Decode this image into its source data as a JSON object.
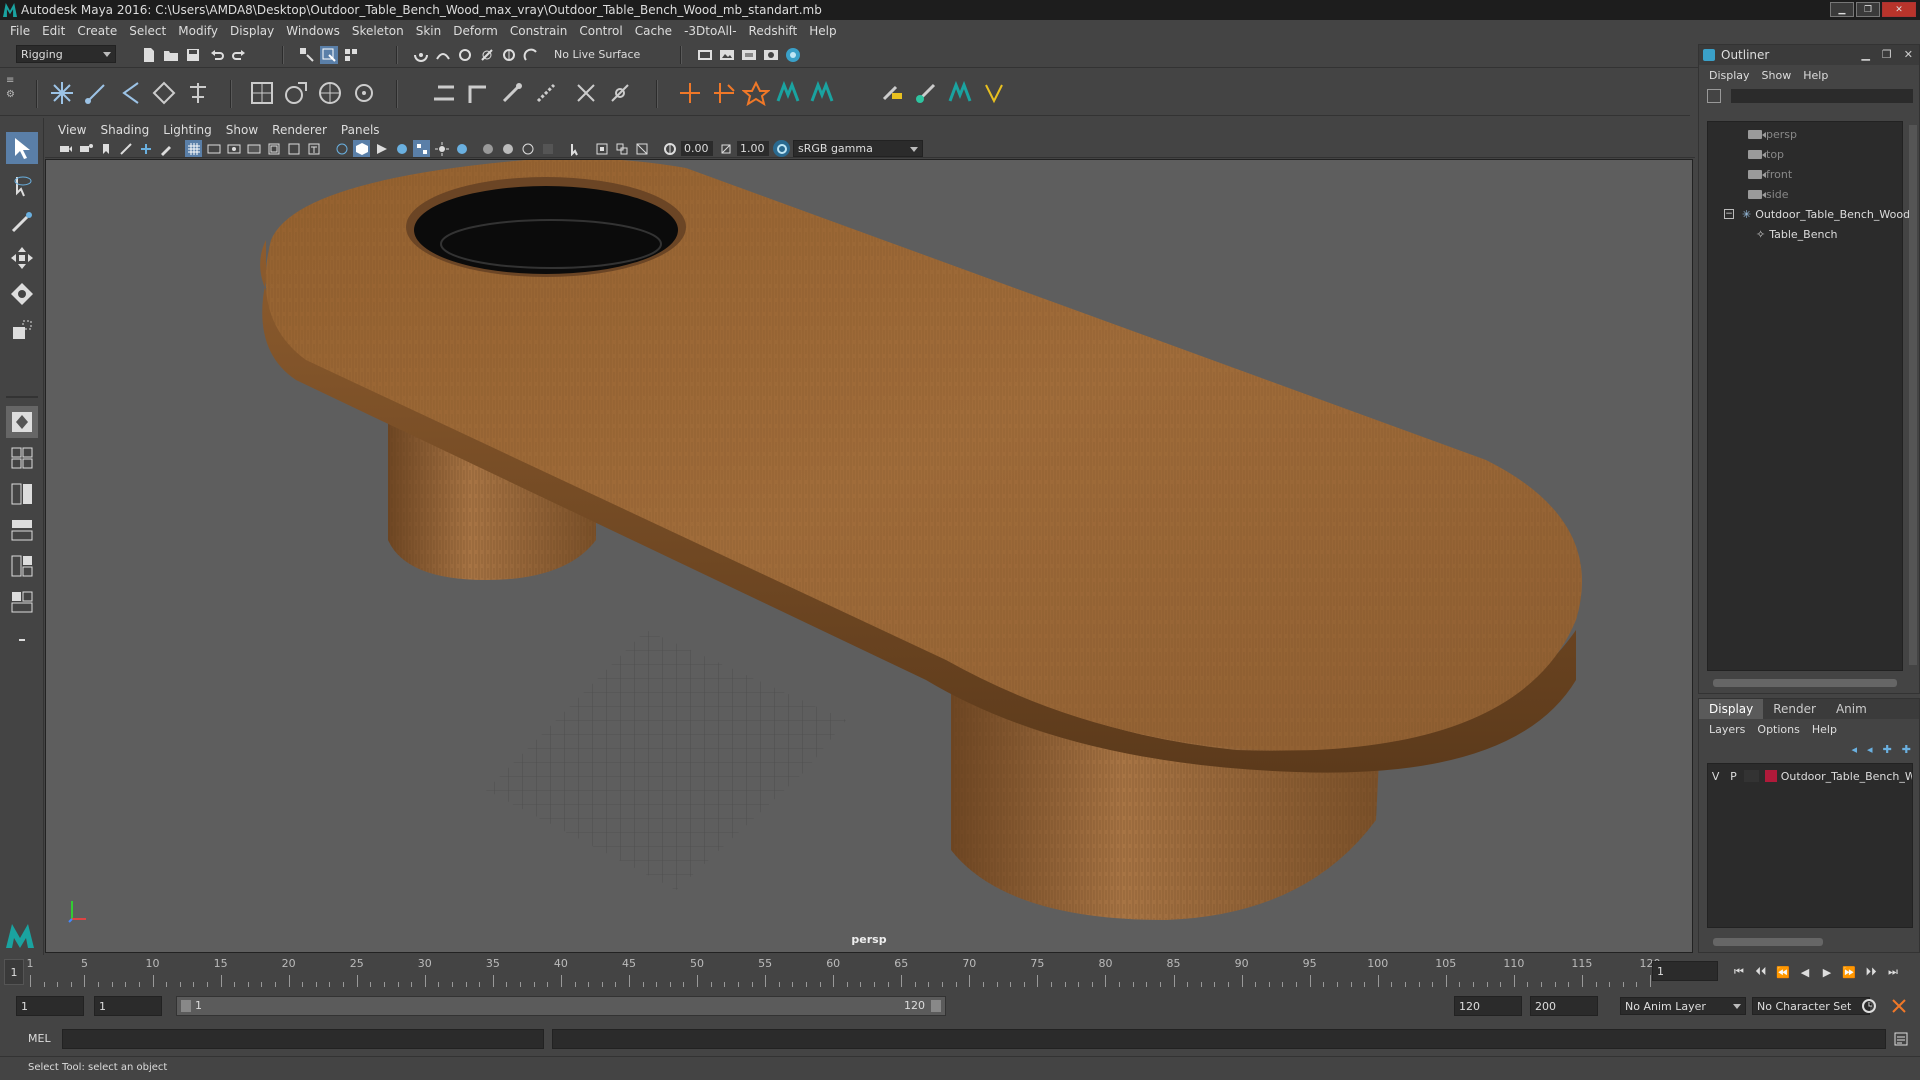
{
  "window": {
    "title": "Autodesk Maya 2016: C:\\Users\\AMDA8\\Desktop\\Outdoor_Table_Bench_Wood_max_vray\\Outdoor_Table_Bench_Wood_mb_standart.mb"
  },
  "menubar": [
    "File",
    "Edit",
    "Create",
    "Select",
    "Modify",
    "Display",
    "Windows",
    "Skeleton",
    "Skin",
    "Deform",
    "Constrain",
    "Control",
    "Cache",
    "-3DtoAll-",
    "Redshift",
    "Help"
  ],
  "statusline": {
    "menuset": "Rigging",
    "live_surface": "No Live Surface"
  },
  "viewport": {
    "menu": [
      "View",
      "Shading",
      "Lighting",
      "Show",
      "Renderer",
      "Panels"
    ],
    "exposure": "0.00",
    "gamma": "1.00",
    "colorspace": "sRGB gamma",
    "camera_label": "persp"
  },
  "outliner": {
    "title": "Outliner",
    "menu": [
      "Display",
      "Show",
      "Help"
    ],
    "items": [
      "persp",
      "top",
      "front",
      "side",
      "Outdoor_Table_Bench_Wood",
      "Table_Bench"
    ]
  },
  "layers": {
    "tabs": [
      "Display",
      "Render",
      "Anim"
    ],
    "menu": [
      "Layers",
      "Options",
      "Help"
    ],
    "row": {
      "v": "V",
      "p": "P",
      "name": "Outdoor_Table_Bench_Wood"
    },
    "swatch_color": "#b01a3a"
  },
  "timeline": {
    "current_frame": "1",
    "labels": [
      "1",
      "5",
      "10",
      "15",
      "20",
      "25",
      "30",
      "35",
      "40",
      "45",
      "50",
      "55",
      "60",
      "65",
      "70",
      "75",
      "80",
      "85",
      "90",
      "95",
      "100",
      "105",
      "110",
      "115",
      "120"
    ],
    "frame_field": "1"
  },
  "range": {
    "start": "1",
    "start_inner": "1",
    "slider_start": "1",
    "slider_end": "120",
    "end": "120",
    "end_total": "200",
    "anim_layer": "No Anim Layer",
    "character_set": "No Character Set"
  },
  "command": {
    "mode": "MEL"
  },
  "helpline": "Select Tool: select an object",
  "colors": {
    "accent": "#3aa0c8",
    "wood": "#9a6a3a"
  }
}
